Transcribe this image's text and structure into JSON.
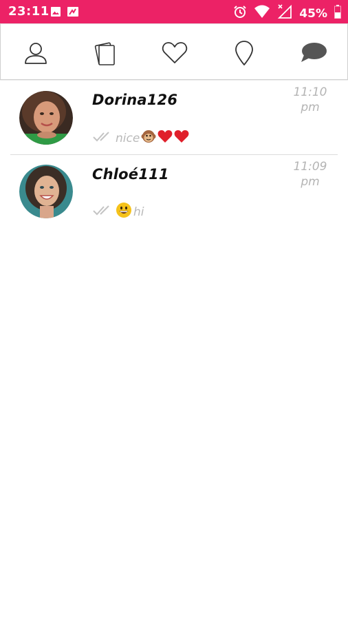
{
  "status_bar": {
    "time": "23:11",
    "battery": "45%",
    "background_color": "#ec2266",
    "icons": [
      "image-notification-icon",
      "file-notification-icon",
      "alarm-icon",
      "wifi-icon",
      "no-signal-icon",
      "battery-icon"
    ]
  },
  "tabs": [
    {
      "name": "profile",
      "icon": "person-icon"
    },
    {
      "name": "cards",
      "icon": "cards-icon"
    },
    {
      "name": "likes",
      "icon": "heart-icon"
    },
    {
      "name": "nearby",
      "icon": "location-pin-icon"
    },
    {
      "name": "messages",
      "icon": "chat-bubble-icon",
      "active": true
    }
  ],
  "conversations": [
    {
      "name": "Dorina126",
      "time_line1": "11:10",
      "time_line2": "pm",
      "preview_text": "nice",
      "preview_emojis": [
        "monkey-face-emoji",
        "red-heart-emoji",
        "red-heart-emoji"
      ],
      "emoji_position": "after"
    },
    {
      "name": "Chloé111",
      "time_line1": "11:09",
      "time_line2": "pm",
      "preview_text": "hi",
      "preview_emojis": [
        "grinning-face-emoji"
      ],
      "emoji_position": "before"
    }
  ]
}
